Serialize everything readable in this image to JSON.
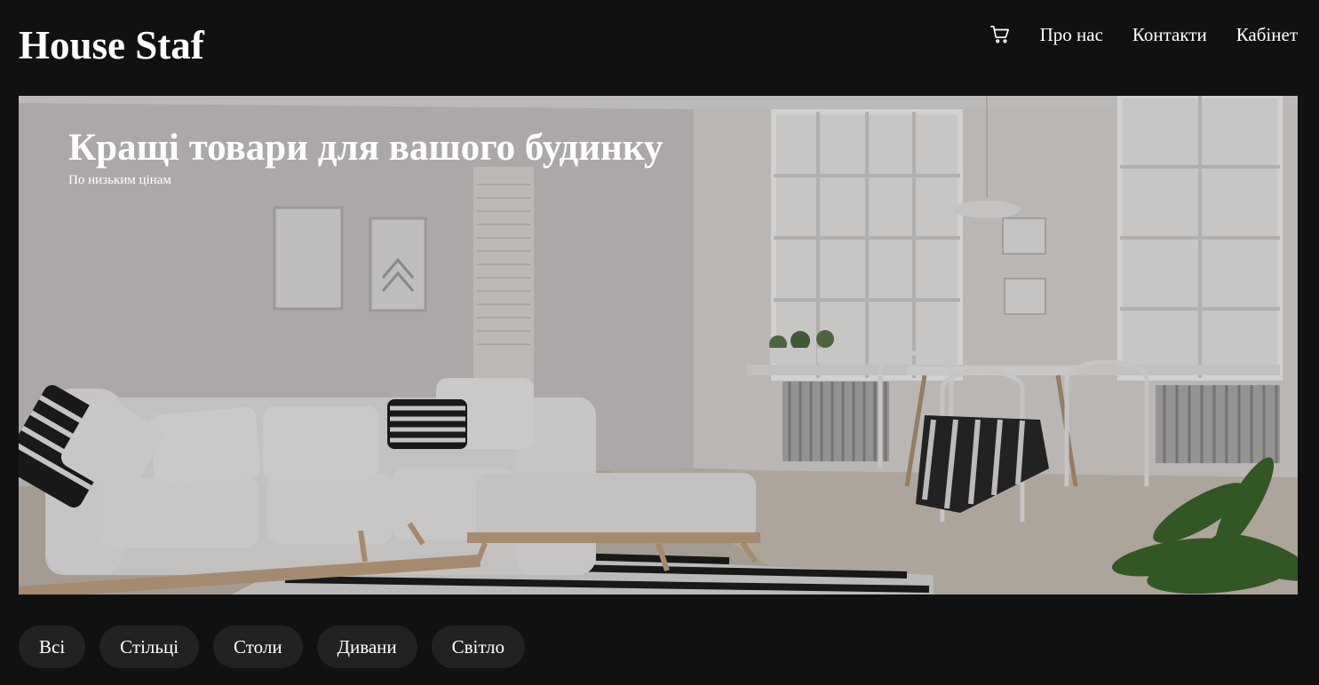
{
  "header": {
    "logo": "House Staf",
    "cart_icon": "cart-icon",
    "nav": [
      {
        "label": "Про нас"
      },
      {
        "label": "Контакти"
      },
      {
        "label": "Кабінет"
      }
    ]
  },
  "hero": {
    "title": "Кращі товари для вашого будинку",
    "subtitle": "По низьким цінам"
  },
  "filters": [
    {
      "label": "Всі"
    },
    {
      "label": "Стільці"
    },
    {
      "label": "Столи"
    },
    {
      "label": "Дивани"
    },
    {
      "label": "Світло"
    }
  ],
  "colors": {
    "background": "#111111",
    "text": "#ffffff",
    "filter_bg": "#222222"
  }
}
